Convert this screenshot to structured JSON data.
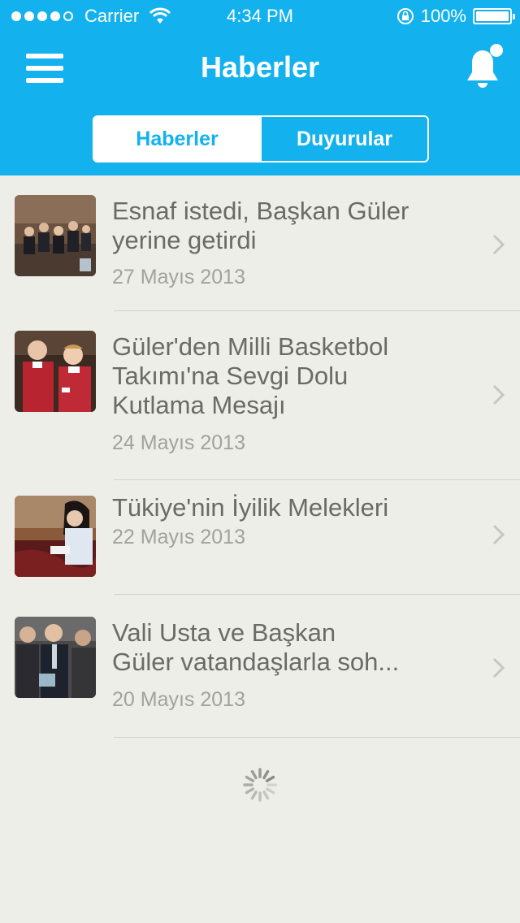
{
  "status_bar": {
    "carrier": "Carrier",
    "time": "4:34 PM",
    "battery": "100%",
    "battery_level": 1.0
  },
  "nav": {
    "title": "Haberler",
    "menu_icon": "hamburger-menu-icon",
    "notification_icon": "bell-icon"
  },
  "tabs": [
    {
      "label": "Haberler",
      "active": true
    },
    {
      "label": "Duyurular",
      "active": false
    }
  ],
  "news": [
    {
      "title_lines": [
        "Esnaf istedi, Başkan Güler",
        "yerine getirdi"
      ],
      "date": "27 Mayıs 2013"
    },
    {
      "title_lines": [
        "Güler'den Milli Basketbol",
        "Takımı'na Sevgi Dolu",
        "Kutlama Mesajı"
      ],
      "date": "24 Mayıs 2013"
    },
    {
      "title_lines": [
        "Tükiye'nin İyilik Melekleri"
      ],
      "date": "22 Mayıs 2013"
    },
    {
      "title_lines": [
        "Vali Usta ve Başkan",
        "Güler vatandaşlarla soh..."
      ],
      "date": "20 Mayıs 2013"
    }
  ],
  "colors": {
    "accent": "#13b2ee",
    "background": "#eeeee9",
    "title_text": "#6a6a66",
    "date_text": "#a2a29d"
  }
}
